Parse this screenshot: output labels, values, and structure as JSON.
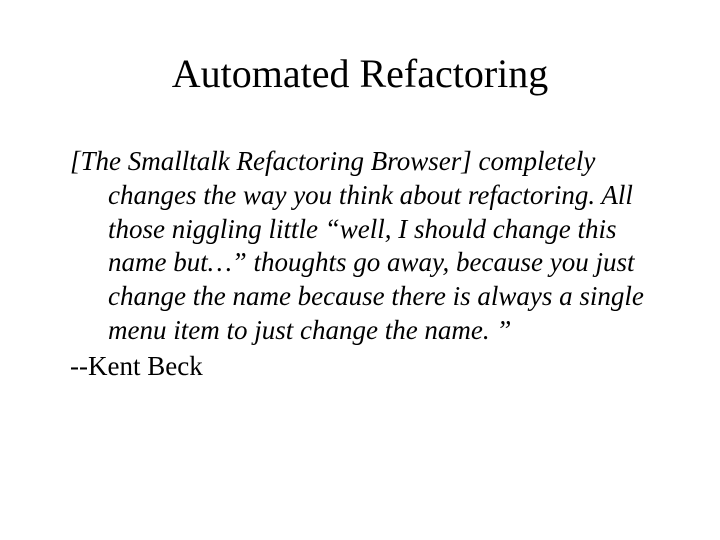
{
  "slide": {
    "title": "Automated Refactoring",
    "quote": "[The Smalltalk Refactoring Browser] completely changes the way you think about refactoring.  All those niggling little “well, I should change this name but…” thoughts go away, because you just change the name because there is always a single menu item to just change the name. ”",
    "attribution": "--Kent Beck"
  }
}
